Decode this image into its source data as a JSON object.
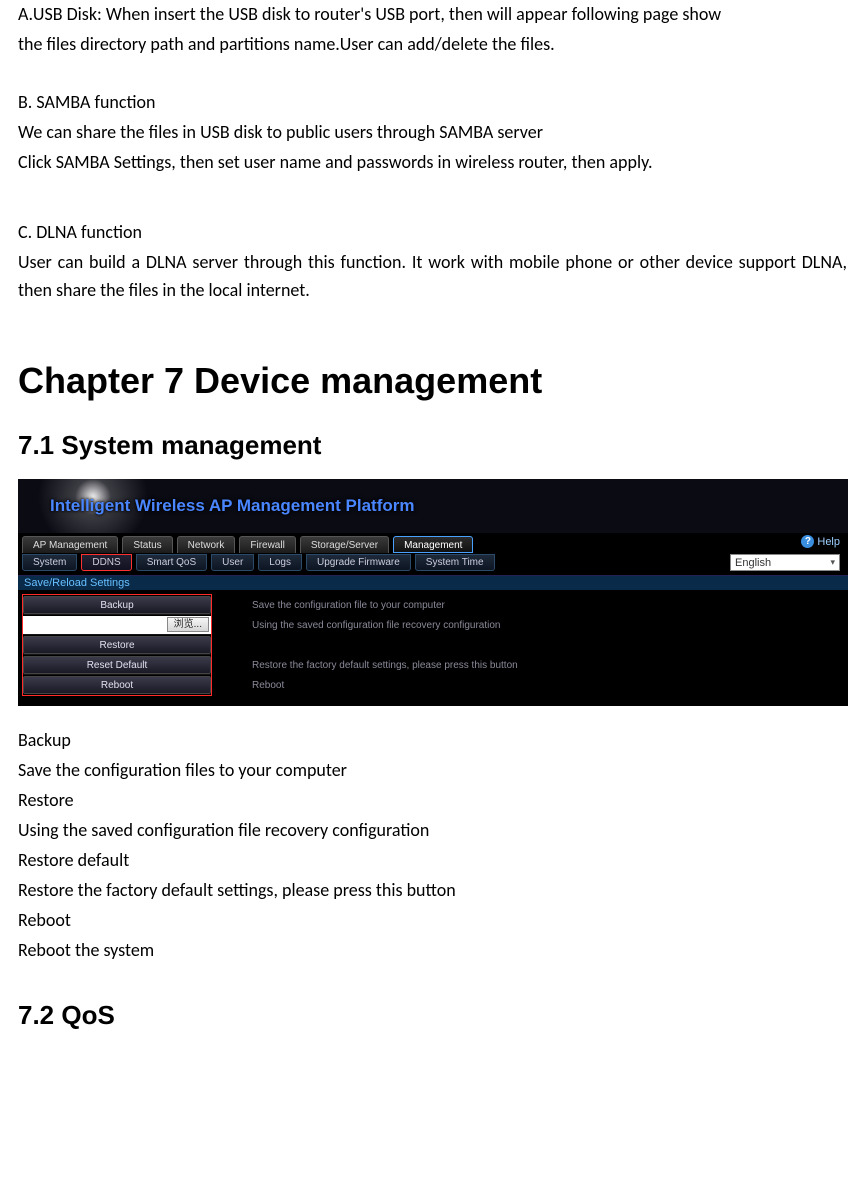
{
  "doc": {
    "paraA1": "A.USB Disk: When insert the USB disk to router's USB port, then will appear following page show",
    "paraA2": "the files directory path and partitions name.User can add/delete the files.",
    "headB": "B. SAMBA function",
    "paraB1": "We can share the files in USB disk to public users through SAMBA server",
    "paraB2": "Click SAMBA Settings, then set user name and passwords in wireless router, then apply.",
    "headC": "C. DLNA function",
    "paraC1": "User can build a DLNA server through this function. It work with mobile phone or other device support DLNA, then share the files in the local internet.",
    "chapter": "Chapter 7 Device management",
    "sec71": "7.1 System management",
    "after1": "Backup",
    "after2": "Save the configuration files to your computer",
    "after3": "Restore",
    "after4": "Using the saved configuration file recovery configuration",
    "after5": "Restore default",
    "after6": "Restore the factory default settings, please press this button",
    "after7": "Reboot",
    "after8": "Reboot the system",
    "sec72": "7.2 QoS"
  },
  "ui": {
    "title": "Intelligent Wireless AP Management Platform",
    "tabs1": [
      "AP Management",
      "Status",
      "Network",
      "Firewall",
      "Storage/Server",
      "Management"
    ],
    "active1": 5,
    "help": "Help",
    "tabs2": [
      "System",
      "DDNS",
      "Smart QoS",
      "User",
      "Logs",
      "Upgrade Firmware",
      "System Time"
    ],
    "active2": 1,
    "lang": "English",
    "section": "Save/Reload Settings",
    "rows": [
      {
        "btn": "Backup",
        "file": false,
        "desc": "Save the configuration file to your computer"
      },
      {
        "btn": "",
        "file": true,
        "browse": "浏览...",
        "desc": "Using the saved configuration file recovery configuration"
      },
      {
        "btn": "Restore",
        "file": false,
        "desc": ""
      },
      {
        "btn": "Reset Default",
        "file": false,
        "desc": "Restore the factory default settings, please press this button"
      },
      {
        "btn": "Reboot",
        "file": false,
        "desc": "Reboot"
      }
    ]
  }
}
